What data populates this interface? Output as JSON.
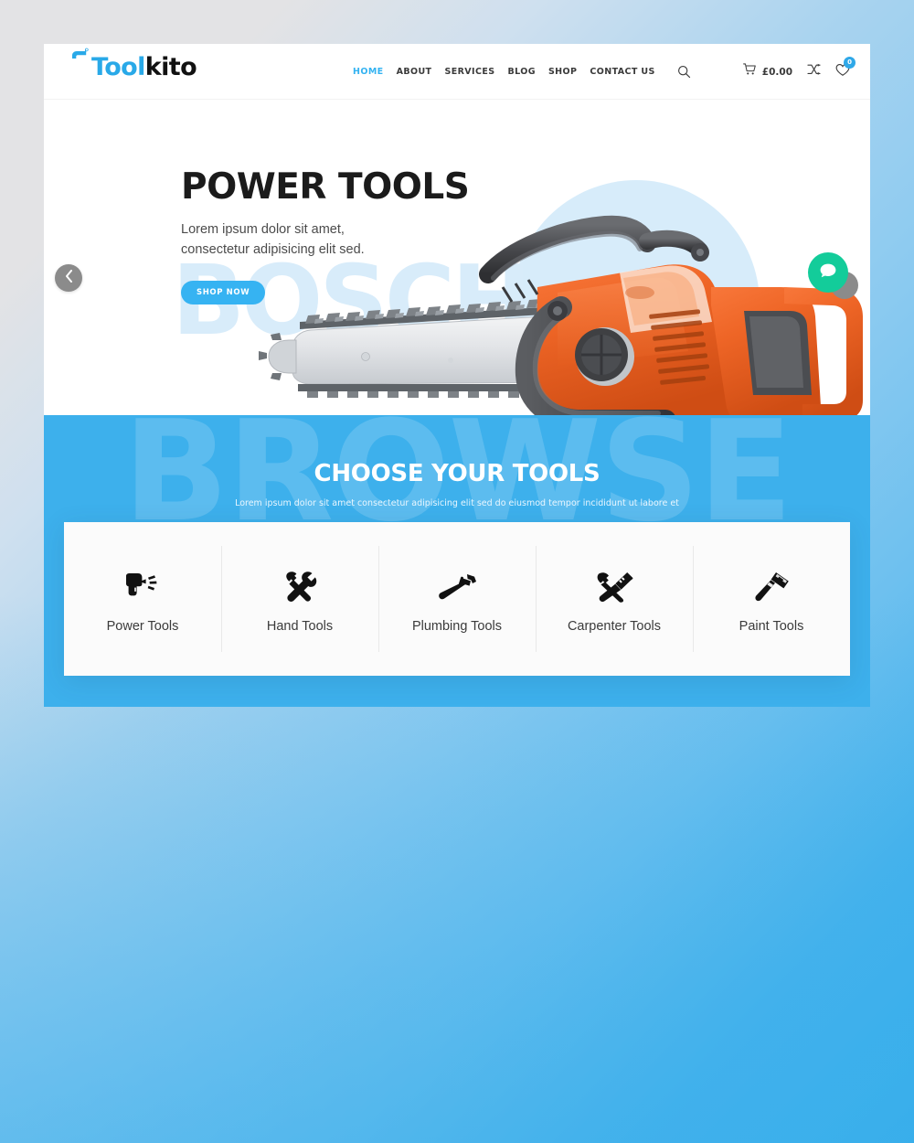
{
  "theme": {
    "brand_blue": "#34b3f1",
    "band_blue": "#3db0ec",
    "accent_green": "#13cc9a",
    "saw_orange": "#ef6425",
    "text_dark": "#1b1b1b"
  },
  "header": {
    "logo": {
      "part1": "Tool",
      "part2": "kito",
      "icon": "hammer-icon"
    },
    "nav": [
      {
        "label": "HOME",
        "active": true
      },
      {
        "label": "ABOUT",
        "active": false
      },
      {
        "label": "SERVICES",
        "active": false
      },
      {
        "label": "BLOG",
        "active": false
      },
      {
        "label": "SHOP",
        "active": false
      },
      {
        "label": "CONTACT US",
        "active": false
      }
    ],
    "search_icon": "search-icon",
    "cart": {
      "icon": "cart-icon",
      "total": "£0.00"
    },
    "compare": {
      "icon": "compare-icon"
    },
    "wishlist": {
      "icon": "heart-icon",
      "count": "0"
    }
  },
  "hero": {
    "watermark": "BOSCH",
    "title": "POWER TOOLS",
    "subtitle": "Lorem ipsum dolor sit amet, consectetur adipisicing elit sed.",
    "cta_label": "SHOP NOW",
    "prev_icon": "chevron-left-icon",
    "next_icon": "chevron-right-icon",
    "chat_icon": "chat-bubble-icon",
    "product_image": "orange-chainsaw"
  },
  "choose": {
    "watermark": "BROWSE",
    "title": "CHOOSE YOUR TOOLS",
    "subtitle": "Lorem ipsum dolor sit amet consectetur adipisicing elit sed do eiusmod tempor incididunt ut labore et"
  },
  "categories": [
    {
      "label": "Power Tools",
      "icon": "drill-icon"
    },
    {
      "label": "Hand Tools",
      "icon": "hammer-wrench-icon"
    },
    {
      "label": "Plumbing Tools",
      "icon": "pipe-wrench-icon"
    },
    {
      "label": "Carpenter Tools",
      "icon": "hammer-saw-icon"
    },
    {
      "label": "Paint Tools",
      "icon": "paint-roller-icon"
    }
  ]
}
